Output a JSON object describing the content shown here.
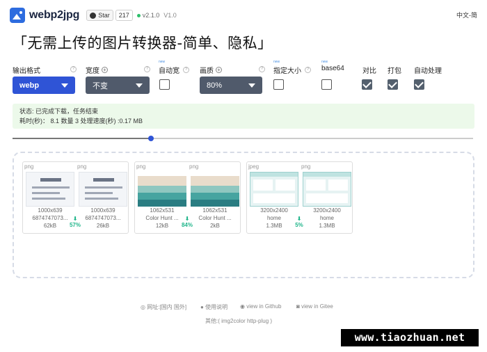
{
  "header": {
    "app_title": "webp2jpg",
    "github_label": "Star",
    "github_count": "217",
    "version": "v2.1.0",
    "version_alt": "V1.0",
    "language": "中文-简"
  },
  "slogan": "「无需上传的图片转换器-简单、隐私」",
  "options": {
    "format_label": "输出格式",
    "format_value": "webp",
    "width_label": "宽度",
    "width_value": "不变",
    "auto_width_label": "自动宽",
    "quality_label": "画质",
    "quality_value": "80%",
    "size_label": "指定大小",
    "base64_label": "base64",
    "compare_label": "对比",
    "pack_label": "打包",
    "auto_label": "自动处理",
    "new_tag": "new"
  },
  "status": {
    "line1": "状态: 已完成下载，任务结束",
    "line2": "耗时(秒)： 8.1 数量 3 处理速度(秒) :0.17 MB"
  },
  "progress": 0.3,
  "cards": [
    {
      "saving": "57%",
      "items": [
        {
          "format": "png",
          "dims": "1000x639",
          "name": "6874747073...",
          "size": "62kB"
        },
        {
          "format": "png",
          "dims": "1000x639",
          "name": "6874747073...",
          "size": "26kB"
        }
      ]
    },
    {
      "saving": "84%",
      "items": [
        {
          "format": "png",
          "dims": "1062x531",
          "name": "Color Hunt ...",
          "size": "12kB"
        },
        {
          "format": "png",
          "dims": "1062x531",
          "name": "Color Hunt ...",
          "size": "2kB"
        }
      ]
    },
    {
      "saving": "5%",
      "items": [
        {
          "format": "jpeg",
          "dims": "3200x2400",
          "name": "home",
          "size": "1.3MB"
        },
        {
          "format": "png",
          "dims": "3200x2400",
          "name": "home",
          "size": "1.3MB"
        }
      ]
    }
  ],
  "footer": {
    "site": "网址:[国内 国外]",
    "manual": "使用说明",
    "github": "view in Github",
    "gitee": "view in Gitee",
    "others": "其他:( img2color   http-plug )"
  },
  "watermark": "www.tiaozhuan.net",
  "colors": {
    "accent": "#2f54d6",
    "success": "#1fb58a",
    "status_bg": "#ecf9ea"
  }
}
